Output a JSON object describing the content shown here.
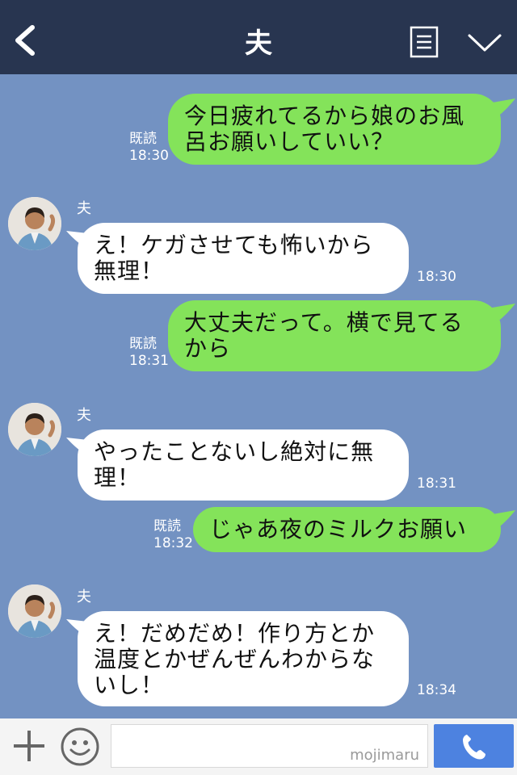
{
  "header": {
    "title": "夫",
    "icons": {
      "back": "back-arrow-icon",
      "menu": "menu-list-icon",
      "more": "chevron-down-icon"
    }
  },
  "messages": [
    {
      "side": "right",
      "text": "今日疲れてるから娘のお風呂お願いしていい？",
      "lines": [
        "今日疲れてるから娘のお風",
        "呂お願いしていい？"
      ],
      "status": "既読",
      "time": "18:30"
    },
    {
      "side": "left",
      "sender": "夫",
      "lines": [
        "え！ケガさせても怖いから",
        "無理！"
      ],
      "time": "18:30"
    },
    {
      "side": "right",
      "lines": [
        "大丈夫だって。横で見てる",
        "から"
      ],
      "status": "既読",
      "time": "18:31"
    },
    {
      "side": "left",
      "sender": "夫",
      "lines": [
        "やったことないし絶対に無",
        "理！"
      ],
      "time": "18:31"
    },
    {
      "side": "right",
      "lines": [
        "じゃあ夜のミルクお願い"
      ],
      "status": "既読",
      "time": "18:32"
    },
    {
      "side": "left",
      "sender": "夫",
      "lines": [
        "え！だめだめ！作り方とか",
        "温度とかぜんぜんわからな",
        "いし！"
      ],
      "time": "18:34"
    }
  ],
  "input_bar": {
    "watermark": "mojimaru",
    "icons": {
      "add": "plus-icon",
      "emoji": "smiley-icon",
      "send": "phone-icon"
    }
  },
  "colors": {
    "header": "#283550",
    "chat_bg": "#7392c2",
    "my_bubble": "#84e35a",
    "their_bubble": "#ffffff",
    "send_button": "#4d82e0"
  }
}
